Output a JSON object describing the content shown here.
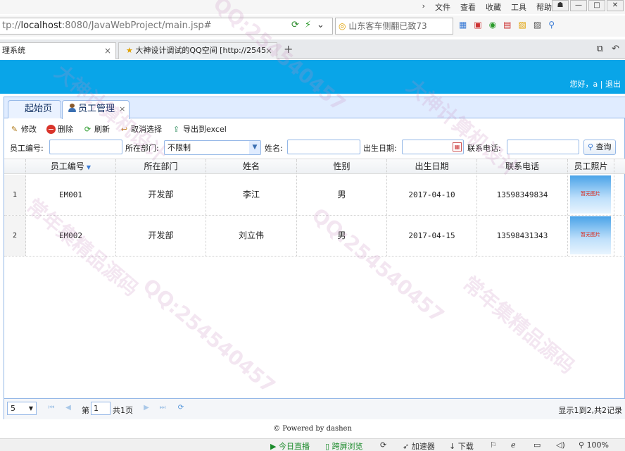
{
  "browser": {
    "menus": [
      "文件",
      "查看",
      "收藏",
      "工具",
      "帮助"
    ],
    "window_buttons": [
      "☗",
      "—",
      "□",
      "✕"
    ],
    "url_prefix": "tp://",
    "url_host": "localhost",
    "url_rest": ":8080/JavaWebProject/main.jsp#",
    "search_placeholder": "山东客车侧翻已致73",
    "tabs": [
      {
        "title": "理系统",
        "close": "×"
      },
      {
        "title": "大神设计调试的QQ空间 [http://2545",
        "close": "×"
      }
    ],
    "new_tab": "+"
  },
  "header": {
    "greeting": "您好，",
    "username": "a",
    "separator": "|",
    "logout": "退出"
  },
  "panel": {
    "tabs": [
      {
        "label": "起始页"
      },
      {
        "label": "员工管理",
        "close": "×"
      }
    ]
  },
  "toolbar": {
    "edit": "修改",
    "delete": "删除",
    "refresh": "刷新",
    "deselect": "取消选择",
    "export": "导出到excel"
  },
  "search": {
    "emp_no_label": "员工编号:",
    "dept_label": "所在部门:",
    "dept_value": "不限制",
    "name_label": "姓名:",
    "birth_label": "出生日期:",
    "phone_label": "联系电话:",
    "query_button": "查询"
  },
  "grid": {
    "columns": [
      "员工编号",
      "所在部门",
      "姓名",
      "性别",
      "出生日期",
      "联系电话",
      "员工照片"
    ],
    "rows": [
      {
        "num": "1",
        "emp_no": "EM001",
        "dept": "开发部",
        "name": "李江",
        "gender": "男",
        "birth": "2017-04-10",
        "phone": "13598349834",
        "photo": "暂无图片"
      },
      {
        "num": "2",
        "emp_no": "EM002",
        "dept": "开发部",
        "name": "刘立伟",
        "gender": "男",
        "birth": "2017-04-15",
        "phone": "13598431343",
        "photo": "暂无图片"
      }
    ]
  },
  "pager": {
    "page_size": "5",
    "page_prefix": "第",
    "page_value": "1",
    "page_suffix": "共1页",
    "info": "显示1到2,共2记录"
  },
  "footer": {
    "text": "© Powered by dashen"
  },
  "statusbar": {
    "live": "今日直播",
    "split": "跨屏浏览",
    "accelerator": "加速器",
    "download": "下载",
    "zoom": "100%"
  },
  "watermarks": [
    "QQ:254540457",
    "大神计算机设计",
    "常年集精品源码"
  ],
  "colors": {
    "header_blue": "#09a5e8",
    "panel_border": "#95b8e7",
    "tab_bg": "#e0ecff"
  }
}
